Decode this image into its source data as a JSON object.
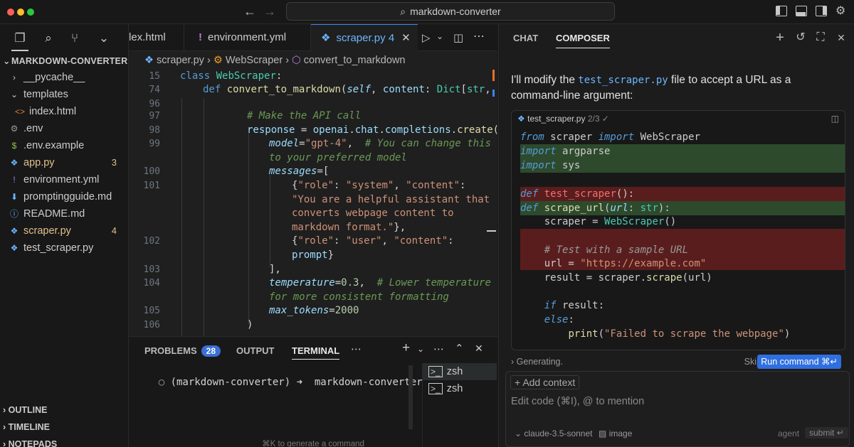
{
  "titlebar": {
    "search_text": "markdown-converter"
  },
  "explorer": {
    "title": "MARKDOWN-CONVERTER",
    "items": [
      {
        "label": "__pycache__",
        "icon": "chevron-right-icon",
        "indent": 1,
        "color": "#cccccc",
        "badge": ""
      },
      {
        "label": "templates",
        "icon": "chevron-down-icon",
        "indent": 1,
        "color": "#cccccc",
        "badge": ""
      },
      {
        "label": "index.html",
        "icon": "html-icon",
        "indent": 2,
        "color": "#cccccc",
        "badge": ""
      },
      {
        "label": ".env",
        "icon": "gear-icon",
        "indent": 1,
        "color": "#cccccc",
        "badge": ""
      },
      {
        "label": ".env.example",
        "icon": "dollar-icon",
        "indent": 1,
        "color": "#cccccc",
        "badge": ""
      },
      {
        "label": "app.py",
        "icon": "python-icon",
        "indent": 1,
        "color": "#e2c08d",
        "badge": "3"
      },
      {
        "label": "environment.yml",
        "icon": "exclamation-icon",
        "indent": 1,
        "color": "#cccccc",
        "badge": ""
      },
      {
        "label": "promptingguide.md",
        "icon": "markdown-icon",
        "indent": 1,
        "color": "#cccccc",
        "badge": ""
      },
      {
        "label": "README.md",
        "icon": "info-icon",
        "indent": 1,
        "color": "#cccccc",
        "badge": ""
      },
      {
        "label": "scraper.py",
        "icon": "python-icon",
        "indent": 1,
        "color": "#e2c08d",
        "badge": "4"
      },
      {
        "label": "test_scraper.py",
        "icon": "python-icon",
        "indent": 1,
        "color": "#cccccc",
        "badge": ""
      }
    ],
    "sections": [
      "OUTLINE",
      "TIMELINE",
      "NOTEPADS"
    ]
  },
  "editor": {
    "tabs": [
      {
        "label": "lex.html"
      },
      {
        "label": "environment.yml"
      },
      {
        "label": "scraper.py",
        "badge": "4"
      }
    ],
    "breadcrumb": [
      "scraper.py",
      "WebScraper",
      "convert_to_markdown"
    ],
    "line_numbers": [
      "15",
      "74",
      "96",
      "97",
      "98",
      "99",
      "",
      "100",
      "101",
      "",
      "",
      "",
      "102",
      "",
      "103",
      "104",
      "",
      "105",
      "106"
    ]
  },
  "panel": {
    "tabs": [
      "PROBLEMS",
      "OUTPUT",
      "TERMINAL"
    ],
    "problems_count": "28",
    "terminal_prompt": "(markdown-converter) ➜  markdown-converter",
    "sessions": [
      "zsh",
      "zsh"
    ],
    "hint": "⌘K to generate a command"
  },
  "composer": {
    "tabs": [
      "CHAT",
      "COMPOSER"
    ],
    "message_before": "I'll modify the ",
    "message_file": "test_scraper.py",
    "message_after": " file to accept a URL as a command-line argument:",
    "block_filename": "test_scraper.py",
    "block_progress": "2/3",
    "status_text": "Generating.",
    "skip_label": "Skip",
    "run_label": "Run command ⌘↵",
    "add_context": "Add context",
    "placeholder": "Edit code (⌘I), @ to mention",
    "model": "claude-3.5-sonnet",
    "image_label": "image",
    "mode": "agent",
    "submit": "submit"
  }
}
